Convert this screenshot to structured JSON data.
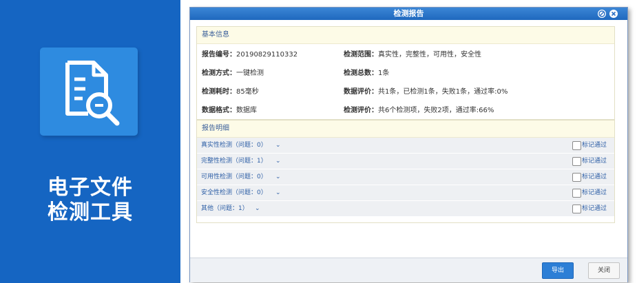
{
  "promo": {
    "title_line1": "电子文件",
    "title_line2": "检测工具",
    "icon": "document-search-icon"
  },
  "dialog": {
    "title": "检测报告",
    "min_icon": "minimize-icon",
    "close_icon": "close-icon"
  },
  "basic_info": {
    "header": "基本信息",
    "items": [
      {
        "label": "报告编号：",
        "value": "20190829110332"
      },
      {
        "label": "检测范围：",
        "value": "真实性，完整性，可用性，安全性"
      },
      {
        "label": "检测方式：",
        "value": "一键检测"
      },
      {
        "label": "检测总数：",
        "value": "1条"
      },
      {
        "label": "检测耗时：",
        "value": "85毫秒"
      },
      {
        "label": "数据评价：",
        "value": "共1条，已检测1条，失败1条，通过率:0%"
      },
      {
        "label": "数据格式：",
        "value": "数据库"
      },
      {
        "label": "检测评价：",
        "value": "共6个检测项，失败2项，通过率:66%"
      }
    ]
  },
  "details": {
    "header": "报告明细",
    "checkbox_label": "标记通过",
    "rows": [
      {
        "label": "真实性检测（问题：0）",
        "checked": false
      },
      {
        "label": "完整性检测（问题：1）",
        "checked": false
      },
      {
        "label": "可用性检测（问题：0）",
        "checked": false
      },
      {
        "label": "安全性检测（问题：0）",
        "checked": false
      },
      {
        "label": "其他（问题：1）",
        "checked": false
      }
    ]
  },
  "footer": {
    "export_label": "导出",
    "close_label": "关闭"
  },
  "colors": {
    "brand_blue": "#1565c2",
    "titlebar_blue": "#2a77cb",
    "link_blue": "#2e5fa6",
    "panel_header_bg": "#fdfbe7"
  }
}
